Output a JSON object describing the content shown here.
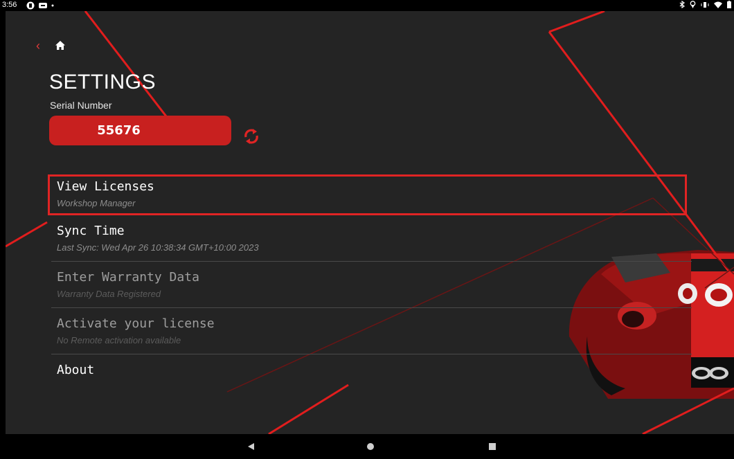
{
  "status_bar": {
    "time": "3:56"
  },
  "header": {
    "title": "SETTINGS"
  },
  "serial": {
    "label": "Serial Number",
    "value": "55676"
  },
  "menu": [
    {
      "title": "View Licenses",
      "subtitle": "Workshop Manager",
      "enabled": true,
      "highlighted": true
    },
    {
      "title": "Sync Time",
      "subtitle": "Last Sync: Wed Apr 26 10:38:34 GMT+10:00 2023",
      "enabled": true
    },
    {
      "title": "Enter Warranty Data",
      "subtitle": "Warranty Data Registered",
      "enabled": false
    },
    {
      "title": "Activate your license",
      "subtitle": "No Remote activation available",
      "enabled": false
    },
    {
      "title": "About",
      "subtitle": "",
      "enabled": true
    }
  ],
  "colors": {
    "accent": "#c8201f",
    "highlight_border": "#e02424",
    "background": "#242424"
  },
  "icons": [
    "back-chevron-icon",
    "home-icon",
    "refresh-icon",
    "nav-back-icon",
    "nav-home-icon",
    "nav-recents-icon"
  ]
}
